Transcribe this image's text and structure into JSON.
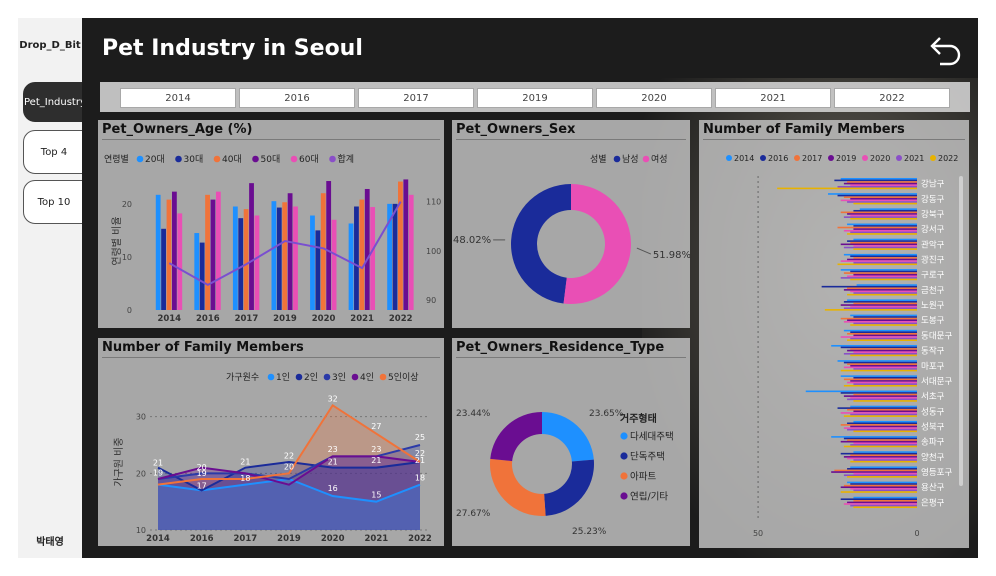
{
  "sidebar": {
    "brand": "Drop_D_Bit",
    "nav": [
      {
        "label": "Pet_Industry",
        "active": true
      },
      {
        "label": "Top 4",
        "active": false
      },
      {
        "label": "Top 10",
        "active": false
      }
    ],
    "author": "박태영"
  },
  "header": {
    "title": "Pet Industry in Seoul",
    "back_icon": "undo-arrow-icon"
  },
  "year_slicer": [
    "2014",
    "2016",
    "2017",
    "2019",
    "2020",
    "2021",
    "2022"
  ],
  "colors": [
    "#1e90ff",
    "#1a2b9a",
    "#f0733a",
    "#6a0d91",
    "#e94fb5",
    "#8a4fc8",
    "#e8b200"
  ],
  "chart_data": [
    {
      "title": "Pet_Owners_Age (%)",
      "type": "bar",
      "legend_title": "연령별",
      "categories": [
        "2014",
        "2016",
        "2017",
        "2019",
        "2020",
        "2021",
        "2022"
      ],
      "y_ticks": [
        "0",
        "10",
        "20"
      ],
      "y2_ticks": [
        "90",
        "100",
        "110"
      ],
      "ylabel": "연령별 비율",
      "ylim": [
        0,
        26
      ],
      "y2lim": [
        88,
        116
      ],
      "series": [
        {
          "name": "20대",
          "values": [
            21.7,
            14.5,
            19.5,
            20.5,
            17.8,
            16.3,
            20.0
          ]
        },
        {
          "name": "30대",
          "values": [
            15.3,
            12.7,
            17.3,
            19.3,
            15.0,
            19.5,
            20.0
          ]
        },
        {
          "name": "40대",
          "values": [
            20.8,
            21.7,
            19.0,
            20.3,
            22.0,
            20.8,
            24.2
          ]
        },
        {
          "name": "50대",
          "values": [
            22.3,
            20.8,
            23.9,
            22.0,
            24.3,
            22.8,
            24.6
          ]
        },
        {
          "name": "60대",
          "values": [
            18.2,
            22.3,
            17.8,
            19.5,
            17.0,
            19.4,
            21.7
          ]
        },
        {
          "name": "합계",
          "type": "line",
          "values": [
            97.5,
            93.1,
            97.3,
            102.0,
            100.5,
            96.5,
            110.0
          ]
        }
      ]
    },
    {
      "title": "Pet_Owners_Sex",
      "type": "pie",
      "legend_title": "성별",
      "series": [
        {
          "name": "남성",
          "value": 48.02,
          "label": "48.02%"
        },
        {
          "name": "여성",
          "value": 51.98,
          "label": "51.98%"
        }
      ]
    },
    {
      "title": "Number of Family Members",
      "type": "area",
      "legend_title": "가구원수",
      "categories": [
        "2014",
        "2016",
        "2017",
        "2019",
        "2020",
        "2021",
        "2022"
      ],
      "ylabel": "가구원 비중",
      "y_ticks": [
        "10",
        "20",
        "30"
      ],
      "ylim": [
        10,
        34
      ],
      "series": [
        {
          "name": "1인",
          "values": [
            18,
            17,
            18,
            19,
            16,
            15,
            18
          ]
        },
        {
          "name": "2인",
          "values": [
            21,
            17,
            21,
            22,
            21,
            21,
            22
          ]
        },
        {
          "name": "3인",
          "values": [
            19,
            20,
            20,
            19,
            23,
            23,
            25
          ]
        },
        {
          "name": "4인",
          "values": [
            19,
            21,
            20,
            18,
            23,
            23,
            22
          ]
        },
        {
          "name": "5인이상",
          "values": [
            18,
            19,
            19,
            20,
            32,
            27,
            22
          ]
        }
      ],
      "data_labels": [
        {
          "text": "21",
          "x": "2014",
          "y": 21
        },
        {
          "text": "19",
          "x": "2014",
          "y": 19.3
        },
        {
          "text": "20",
          "x": "2016",
          "y": 20.2
        },
        {
          "text": "19",
          "x": "2016",
          "y": 19.2
        },
        {
          "text": "17",
          "x": "2016",
          "y": 17
        },
        {
          "text": "21",
          "x": "2017",
          "y": 21.2
        },
        {
          "text": "18",
          "x": "2017",
          "y": 18.3
        },
        {
          "text": "22",
          "x": "2019",
          "y": 22.3
        },
        {
          "text": "20",
          "x": "2019",
          "y": 20.3
        },
        {
          "text": "32",
          "x": "2020",
          "y": 32.3
        },
        {
          "text": "23",
          "x": "2020",
          "y": 23.4
        },
        {
          "text": "21",
          "x": "2020",
          "y": 21.2
        },
        {
          "text": "16",
          "x": "2020",
          "y": 16.5
        },
        {
          "text": "27",
          "x": "2021",
          "y": 27.5
        },
        {
          "text": "23",
          "x": "2021",
          "y": 23.4
        },
        {
          "text": "21",
          "x": "2021",
          "y": 21.5
        },
        {
          "text": "15",
          "x": "2021",
          "y": 15.4
        },
        {
          "text": "25",
          "x": "2022",
          "y": 25.5
        },
        {
          "text": "22",
          "x": "2022",
          "y": 22.7
        },
        {
          "text": "21",
          "x": "2022",
          "y": 21.5
        },
        {
          "text": "18",
          "x": "2022",
          "y": 18.4
        }
      ]
    },
    {
      "title": "Pet_Owners_Residence_Type",
      "type": "pie",
      "legend_title": "거주형태",
      "series": [
        {
          "name": "다세대주택",
          "value": 23.65,
          "label": "23.65%"
        },
        {
          "name": "단독주택",
          "value": 25.23,
          "label": "25.23%"
        },
        {
          "name": "아파트",
          "value": 27.67,
          "label": "27.67%"
        },
        {
          "name": "연립/기타",
          "value": 23.44,
          "label": "23.44%"
        }
      ]
    },
    {
      "title": "Number of Family Members",
      "type": "bar",
      "orientation": "horizontal",
      "x_ticks": [
        "50",
        "0"
      ],
      "xlim": [
        0,
        56
      ],
      "categories": [
        "강남구",
        "강동구",
        "강북구",
        "강서구",
        "관악구",
        "광진구",
        "구로구",
        "금천구",
        "노원구",
        "도봉구",
        "동대문구",
        "동작구",
        "마포구",
        "서대문구",
        "서초구",
        "성동구",
        "성북구",
        "송파구",
        "양천구",
        "영등포구",
        "용산구",
        "은평구"
      ],
      "series": [
        {
          "name": "2014",
          "values": [
            24,
            28,
            18,
            22,
            20,
            23,
            24,
            19,
            22,
            21,
            23,
            27,
            25,
            24,
            35,
            21,
            20,
            27,
            20,
            21,
            22,
            20
          ]
        },
        {
          "name": "2016",
          "values": [
            26,
            25,
            20,
            20,
            22,
            21,
            21,
            30,
            23,
            20,
            21,
            24,
            23,
            20,
            24,
            25,
            22,
            23,
            24,
            22,
            21,
            24
          ]
        },
        {
          "name": "2017",
          "values": [
            22,
            23,
            24,
            25,
            21,
            20,
            23,
            22,
            20,
            24,
            22,
            21,
            22,
            23,
            20,
            22,
            24,
            22,
            21,
            26,
            23,
            20
          ]
        },
        {
          "name": "2019",
          "values": [
            23,
            21,
            22,
            20,
            24,
            22,
            20,
            23,
            24,
            22,
            20,
            22,
            21,
            21,
            23,
            20,
            21,
            24,
            23,
            27,
            24,
            22
          ]
        },
        {
          "name": "2020",
          "values": [
            21,
            24,
            21,
            23,
            20,
            24,
            22,
            21,
            21,
            23,
            24,
            20,
            23,
            22,
            21,
            24,
            23,
            20,
            22,
            20,
            21,
            23
          ]
        },
        {
          "name": "2021",
          "values": [
            25,
            22,
            23,
            21,
            23,
            20,
            24,
            20,
            23,
            20,
            21,
            23,
            20,
            20,
            22,
            21,
            22,
            21,
            20,
            23,
            20,
            21
          ]
        },
        {
          "name": "2022",
          "values": [
            44,
            20,
            21,
            22,
            20,
            25,
            21,
            22,
            29,
            21,
            22,
            21,
            24,
            23,
            20,
            23,
            20,
            23,
            21,
            22,
            24,
            20
          ]
        }
      ]
    }
  ]
}
